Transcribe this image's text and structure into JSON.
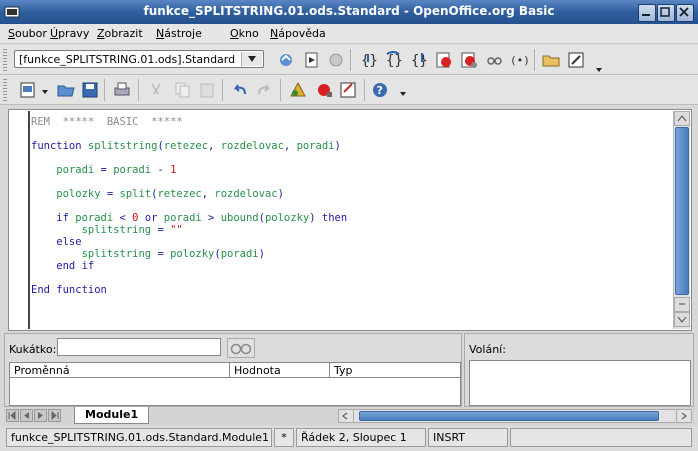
{
  "window": {
    "title": "funkce_SPLITSTRING.01.ods.Standard - OpenOffice.org Basic"
  },
  "menu": {
    "items": [
      "Soubor",
      "Úpravy",
      "Zobrazit",
      "Nástroje",
      "Okno",
      "Nápověda"
    ]
  },
  "toolbar": {
    "library_select_value": "[funkce_SPLITSTRING.01.ods].Standard"
  },
  "editor": {
    "lines": [
      {
        "parts": [
          {
            "t": "REM  *****  BASIC  *****",
            "c": "comment"
          }
        ]
      },
      {
        "parts": []
      },
      {
        "parts": [
          {
            "t": "function ",
            "c": "kw"
          },
          {
            "t": "splitstring",
            "c": "id"
          },
          {
            "t": "(",
            "c": "op"
          },
          {
            "t": "retezec",
            "c": "id"
          },
          {
            "t": ", ",
            "c": "op"
          },
          {
            "t": "rozdelovac",
            "c": "id"
          },
          {
            "t": ", ",
            "c": "op"
          },
          {
            "t": "poradi",
            "c": "id"
          },
          {
            "t": ")",
            "c": "op"
          }
        ]
      },
      {
        "parts": []
      },
      {
        "parts": [
          {
            "t": "    ",
            "c": "op"
          },
          {
            "t": "poradi",
            "c": "id"
          },
          {
            "t": " = ",
            "c": "op"
          },
          {
            "t": "poradi",
            "c": "id"
          },
          {
            "t": " - ",
            "c": "op"
          },
          {
            "t": "1",
            "c": "num"
          }
        ]
      },
      {
        "parts": []
      },
      {
        "parts": [
          {
            "t": "    ",
            "c": "op"
          },
          {
            "t": "polozky",
            "c": "id"
          },
          {
            "t": " = ",
            "c": "op"
          },
          {
            "t": "split",
            "c": "id"
          },
          {
            "t": "(",
            "c": "op"
          },
          {
            "t": "retezec",
            "c": "id"
          },
          {
            "t": ", ",
            "c": "op"
          },
          {
            "t": "rozdelovac",
            "c": "id"
          },
          {
            "t": ")",
            "c": "op"
          }
        ]
      },
      {
        "parts": []
      },
      {
        "parts": [
          {
            "t": "    if ",
            "c": "kw"
          },
          {
            "t": "poradi",
            "c": "id"
          },
          {
            "t": " < ",
            "c": "op"
          },
          {
            "t": "0",
            "c": "num"
          },
          {
            "t": " or ",
            "c": "kw"
          },
          {
            "t": "poradi",
            "c": "id"
          },
          {
            "t": " > ",
            "c": "op"
          },
          {
            "t": "ubound",
            "c": "id"
          },
          {
            "t": "(",
            "c": "op"
          },
          {
            "t": "polozky",
            "c": "id"
          },
          {
            "t": ") ",
            "c": "op"
          },
          {
            "t": "then",
            "c": "kw"
          }
        ]
      },
      {
        "parts": [
          {
            "t": "        ",
            "c": "op"
          },
          {
            "t": "splitstring",
            "c": "id"
          },
          {
            "t": " = ",
            "c": "op"
          },
          {
            "t": "\"\"",
            "c": "str"
          }
        ]
      },
      {
        "parts": [
          {
            "t": "    else",
            "c": "kw"
          }
        ]
      },
      {
        "parts": [
          {
            "t": "        ",
            "c": "op"
          },
          {
            "t": "splitstring",
            "c": "id"
          },
          {
            "t": " = ",
            "c": "op"
          },
          {
            "t": "polozky",
            "c": "id"
          },
          {
            "t": "(",
            "c": "op"
          },
          {
            "t": "poradi",
            "c": "id"
          },
          {
            "t": ")",
            "c": "op"
          }
        ]
      },
      {
        "parts": [
          {
            "t": "    end if",
            "c": "kw"
          }
        ]
      },
      {
        "parts": []
      },
      {
        "parts": [
          {
            "t": "End function",
            "c": "kw"
          }
        ]
      }
    ]
  },
  "watch": {
    "label": "Kukátko:",
    "input_value": "",
    "columns": [
      "Proměnná",
      "Hodnota",
      "Typ"
    ]
  },
  "calls": {
    "label": "Volání:"
  },
  "tabs": {
    "active": "Module1"
  },
  "status": {
    "module": "funkce_SPLITSTRING.01.ods.Standard.Module1",
    "modified": "*",
    "position": "Řádek 2, Sloupec 1",
    "mode": "INSRT"
  },
  "colors": {
    "comment": "#8c8c8c",
    "keyword": "#1c1c9c",
    "identifier": "#28904a",
    "number": "#d01010",
    "titlebar": "#2f5f9f"
  }
}
